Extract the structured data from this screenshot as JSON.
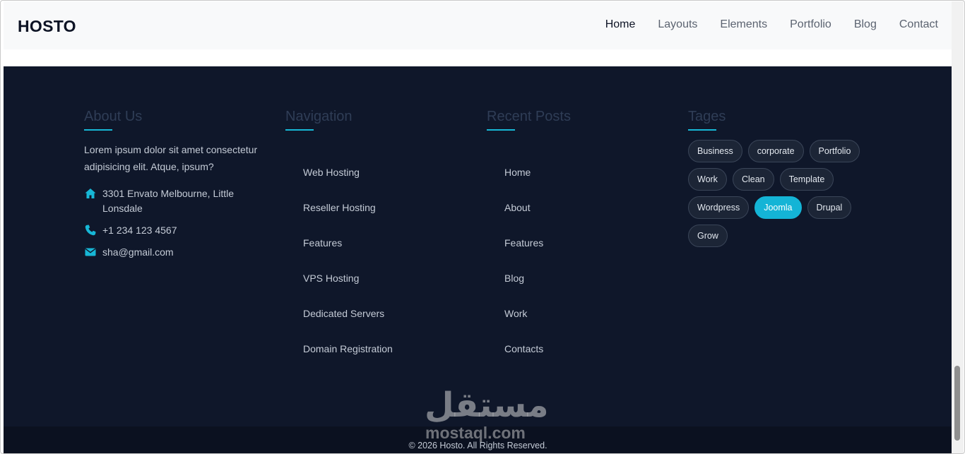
{
  "brand": "HOSTO",
  "nav": [
    "Home",
    "Layouts",
    "Elements",
    "Portfolio",
    "Blog",
    "Contact"
  ],
  "about": {
    "title": "About Us",
    "text": "Lorem ipsum dolor sit amet consectetur adipisicing elit. Atque, ipsum?",
    "address": "3301 Envato Melbourne, Little Lonsdale",
    "phone": "+1 234 123 4567",
    "email": "sha@gmail.com"
  },
  "navigation": {
    "title": "Navigation",
    "items": [
      "Web Hosting",
      "Reseller Hosting",
      "Features",
      "VPS Hosting",
      "Dedicated Servers",
      "Domain Registration"
    ]
  },
  "recent": {
    "title": "Recent Posts",
    "items": [
      "Home",
      "About",
      "Features",
      "Blog",
      "Work",
      "Contacts"
    ]
  },
  "tags": {
    "title": "Tages",
    "items": [
      "Business",
      "corporate",
      "Portfolio",
      "Work",
      "Clean",
      "Template",
      "Wordpress",
      "Joomla",
      "Drupal",
      "Grow"
    ]
  },
  "copyright": "© 2026 Hosto. All Rights Reserved.",
  "watermark": {
    "arabic": "مستقل",
    "latin": "mostaql.com"
  },
  "colors": {
    "accent": "#17b7d6",
    "footer_bg": "#0f172a",
    "navbar_bg": "#f8f9fa"
  },
  "icons": [
    "home-icon",
    "phone-icon",
    "envelope-icon"
  ]
}
